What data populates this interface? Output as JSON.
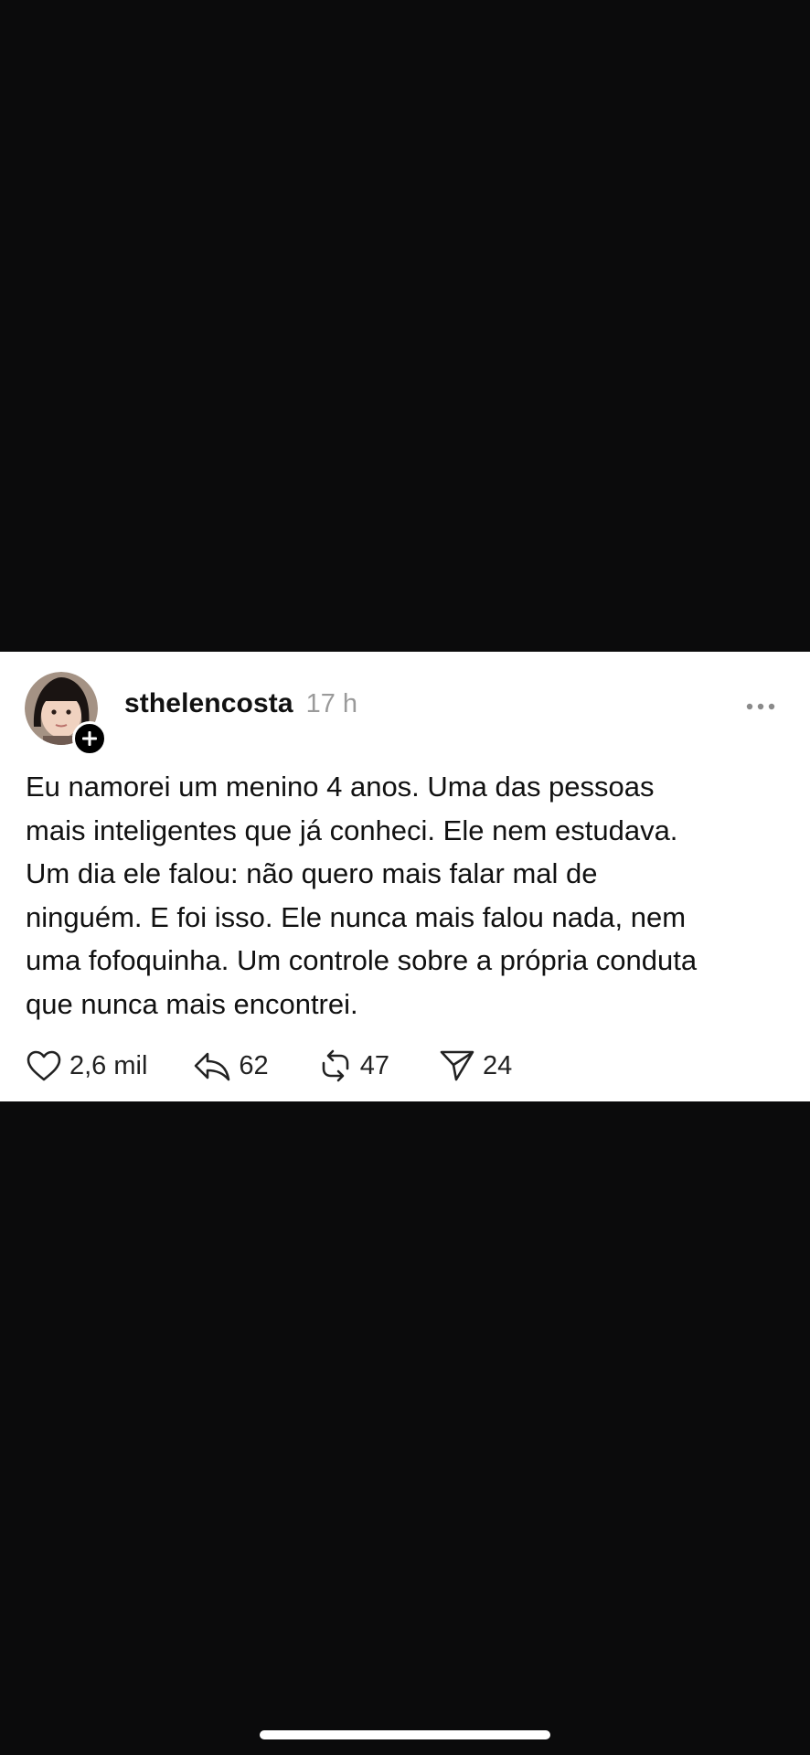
{
  "post": {
    "username": "sthelencosta",
    "timestamp": "17 h",
    "text_lines": [
      "Eu namorei um menino 4 anos. Uma das pessoas",
      "mais inteligentes que já conheci. Ele nem estudava.",
      "Um dia ele falou: não quero mais falar mal de",
      "ninguém. E foi isso. Ele nunca mais falou nada, nem",
      "uma fofoquinha. Um controle sobre a própria conduta",
      "que nunca mais encontrei."
    ],
    "actions": {
      "likes": "2,6 mil",
      "replies": "62",
      "reposts": "47",
      "shares": "24"
    }
  },
  "icons": {
    "follow": "plus-icon",
    "more": "more-horizontal-icon",
    "like": "heart-icon",
    "reply": "reply-icon",
    "repost": "repost-icon",
    "share": "send-icon"
  },
  "colors": {
    "background": "#0b0b0c",
    "card": "#ffffff",
    "text": "#111111",
    "muted": "#9a9a9a"
  }
}
